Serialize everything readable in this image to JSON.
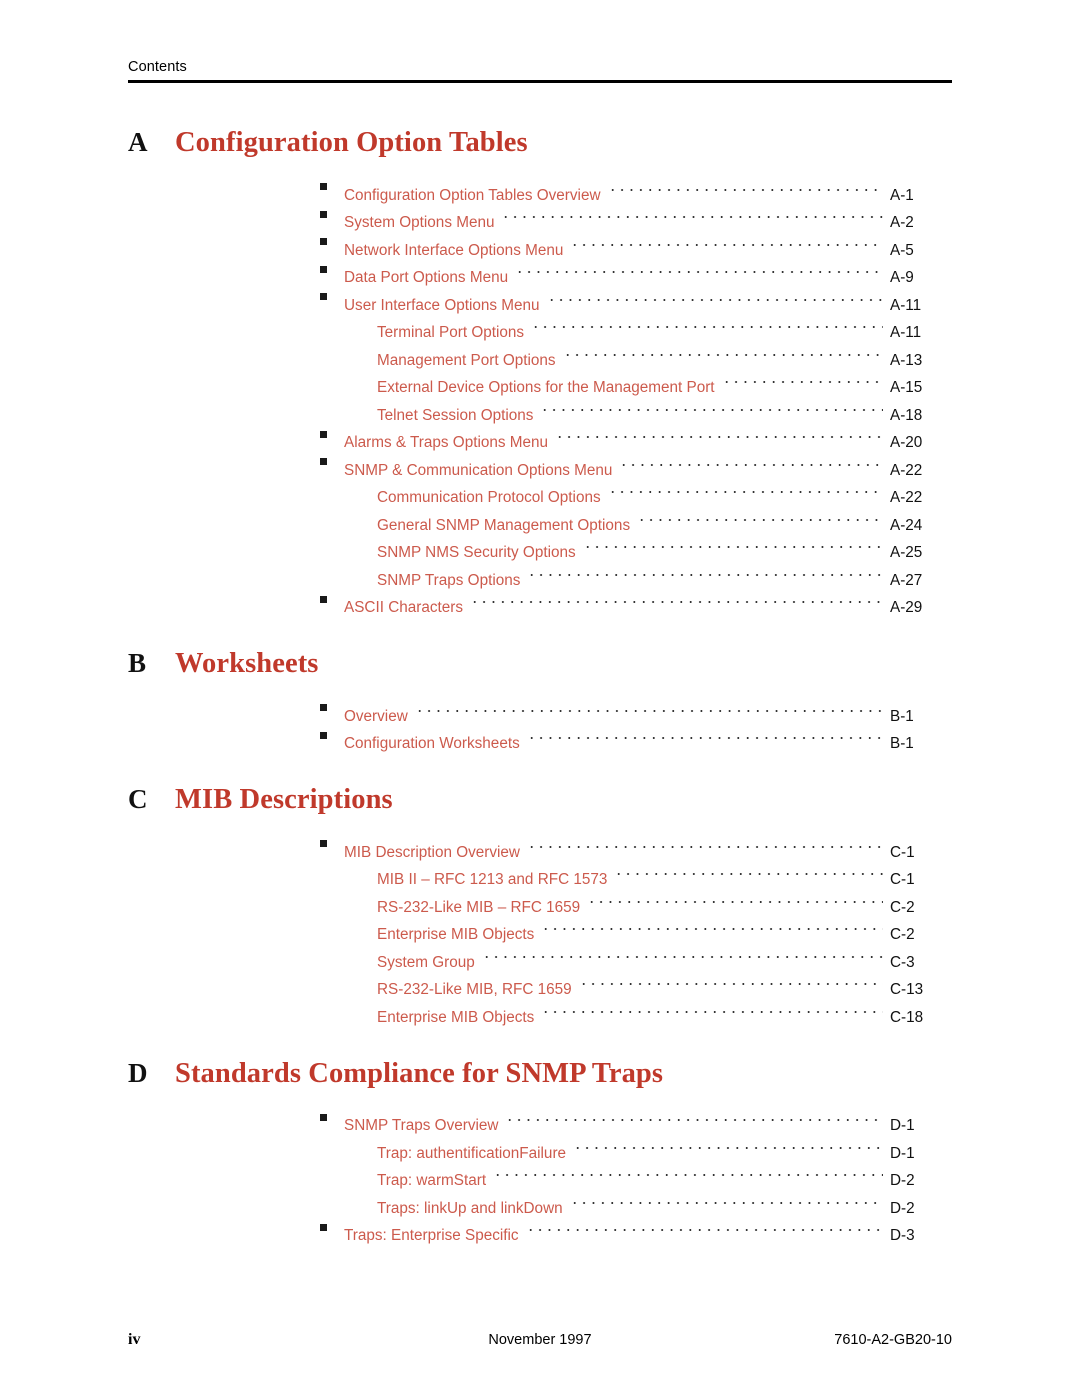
{
  "header": {
    "label": "Contents"
  },
  "colors": {
    "appendix_title": "#c0392b",
    "toc_entry": "#cc5a4c",
    "text": "#000000",
    "leader_dots": "#333333"
  },
  "appendices": [
    {
      "letter": "A",
      "title": "Configuration Option Tables",
      "entries": [
        {
          "level": 1,
          "label": "Configuration Option Tables Overview",
          "page": "A-1"
        },
        {
          "level": 1,
          "label": "System Options Menu",
          "page": "A-2"
        },
        {
          "level": 1,
          "label": "Network Interface Options Menu",
          "page": "A-5"
        },
        {
          "level": 1,
          "label": "Data Port Options Menu",
          "page": "A-9"
        },
        {
          "level": 1,
          "label": "User Interface Options Menu",
          "page": "A-11"
        },
        {
          "level": 2,
          "label": "Terminal Port Options",
          "page": "A-11"
        },
        {
          "level": 2,
          "label": "Management Port Options",
          "page": "A-13"
        },
        {
          "level": 2,
          "label": "External Device Options for the Management Port",
          "page": "A-15"
        },
        {
          "level": 2,
          "label": "Telnet Session Options",
          "page": "A-18"
        },
        {
          "level": 1,
          "label": "Alarms & Traps Options Menu",
          "page": "A-20"
        },
        {
          "level": 1,
          "label": "SNMP & Communication Options Menu",
          "page": "A-22"
        },
        {
          "level": 2,
          "label": "Communication Protocol Options",
          "page": "A-22"
        },
        {
          "level": 2,
          "label": "General SNMP Management Options",
          "page": "A-24"
        },
        {
          "level": 2,
          "label": "SNMP NMS Security Options",
          "page": "A-25"
        },
        {
          "level": 2,
          "label": "SNMP Traps Options",
          "page": "A-27"
        },
        {
          "level": 1,
          "label": "ASCII Characters",
          "page": "A-29"
        }
      ]
    },
    {
      "letter": "B",
      "title": "Worksheets",
      "entries": [
        {
          "level": 1,
          "label": "Overview",
          "page": "B-1"
        },
        {
          "level": 1,
          "label": "Configuration Worksheets",
          "page": "B-1"
        }
      ]
    },
    {
      "letter": "C",
      "title": "MIB Descriptions",
      "entries": [
        {
          "level": 1,
          "label": "MIB Description Overview",
          "page": "C-1"
        },
        {
          "level": 2,
          "label": "MIB II – RFC 1213 and RFC 1573",
          "page": "C-1"
        },
        {
          "level": 2,
          "label": "RS-232-Like MIB – RFC 1659",
          "page": "C-2"
        },
        {
          "level": 2,
          "label": "Enterprise MIB Objects",
          "page": "C-2"
        },
        {
          "level": 2,
          "label": "System Group",
          "page": "C-3"
        },
        {
          "level": 2,
          "label": "RS-232-Like MIB, RFC 1659",
          "page": "C-13"
        },
        {
          "level": 2,
          "label": "Enterprise MIB Objects",
          "page": "C-18"
        }
      ]
    },
    {
      "letter": "D",
      "title": "Standards Compliance for SNMP Traps",
      "entries": [
        {
          "level": 1,
          "label": "SNMP Traps Overview",
          "page": "D-1"
        },
        {
          "level": 2,
          "label": "Trap: authentificationFailure",
          "page": "D-1"
        },
        {
          "level": 2,
          "label": "Trap: warmStart",
          "page": "D-2"
        },
        {
          "level": 2,
          "label": "Traps: linkUp and linkDown",
          "page": "D-2"
        },
        {
          "level": 1,
          "label": "Traps: Enterprise Specific",
          "page": "D-3"
        }
      ]
    }
  ],
  "footer": {
    "page_number": "iv",
    "date": "November 1997",
    "doc_number": "7610-A2-GB20-10"
  }
}
